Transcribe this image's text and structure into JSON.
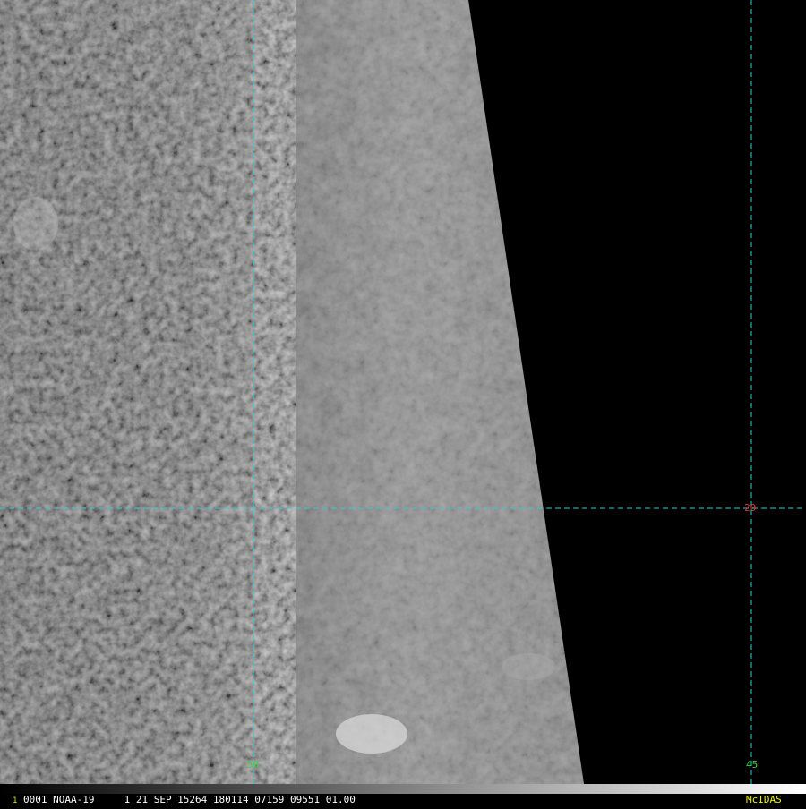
{
  "image": {
    "frame_number": "1",
    "status_line": "0001 NOAA-19     1 21 SEP 15264 180114 07159 09551 01.00",
    "software_label": "McIDAS",
    "colors": {
      "grid": "#22d3d3",
      "lon_label": "#3fcf3f",
      "lat_label": "#e03030",
      "frame_number": "#e0e000",
      "status_text": "#ffffff",
      "software_label": "#f0f000",
      "space": "#000000"
    }
  },
  "grid_labels": {
    "lon_west": "50",
    "lon_east": "45",
    "lat": "20"
  }
}
